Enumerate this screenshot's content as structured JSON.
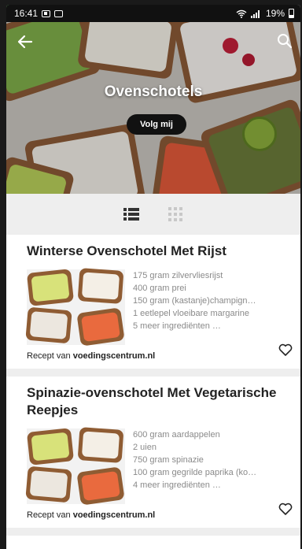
{
  "status_bar": {
    "time": "16:41",
    "battery": "19%"
  },
  "header": {
    "title": "Ovenschotels",
    "follow_label": "Volg mij"
  },
  "view_toggle": {
    "list_icon": "list-icon",
    "grid_icon": "grid-icon"
  },
  "recipes": [
    {
      "title": "Winterse Ovenschotel Met Rijst",
      "ingredients": [
        "175 gram zilvervliesrijst",
        "400 gram prei",
        "150 gram (kastanje)champign…",
        "1 eetlepel vloeibare margarine",
        "5 meer ingrediënten …"
      ],
      "source_prefix": "Recept van ",
      "source": "voedingscentrum.nl"
    },
    {
      "title": "Spinazie-ovenschotel Met Vegetarische Reepjes",
      "ingredients": [
        "600 gram aardappelen",
        "2 uien",
        "750 gram spinazie",
        "100 gram gegrilde paprika (ko…",
        "4 meer ingrediënten …"
      ],
      "source_prefix": "Recept van ",
      "source": "voedingscentrum.nl"
    }
  ],
  "colors": {
    "accent": "#3cc13b",
    "follow_button": "#111111",
    "toggle_bar": "#eeeeee"
  }
}
